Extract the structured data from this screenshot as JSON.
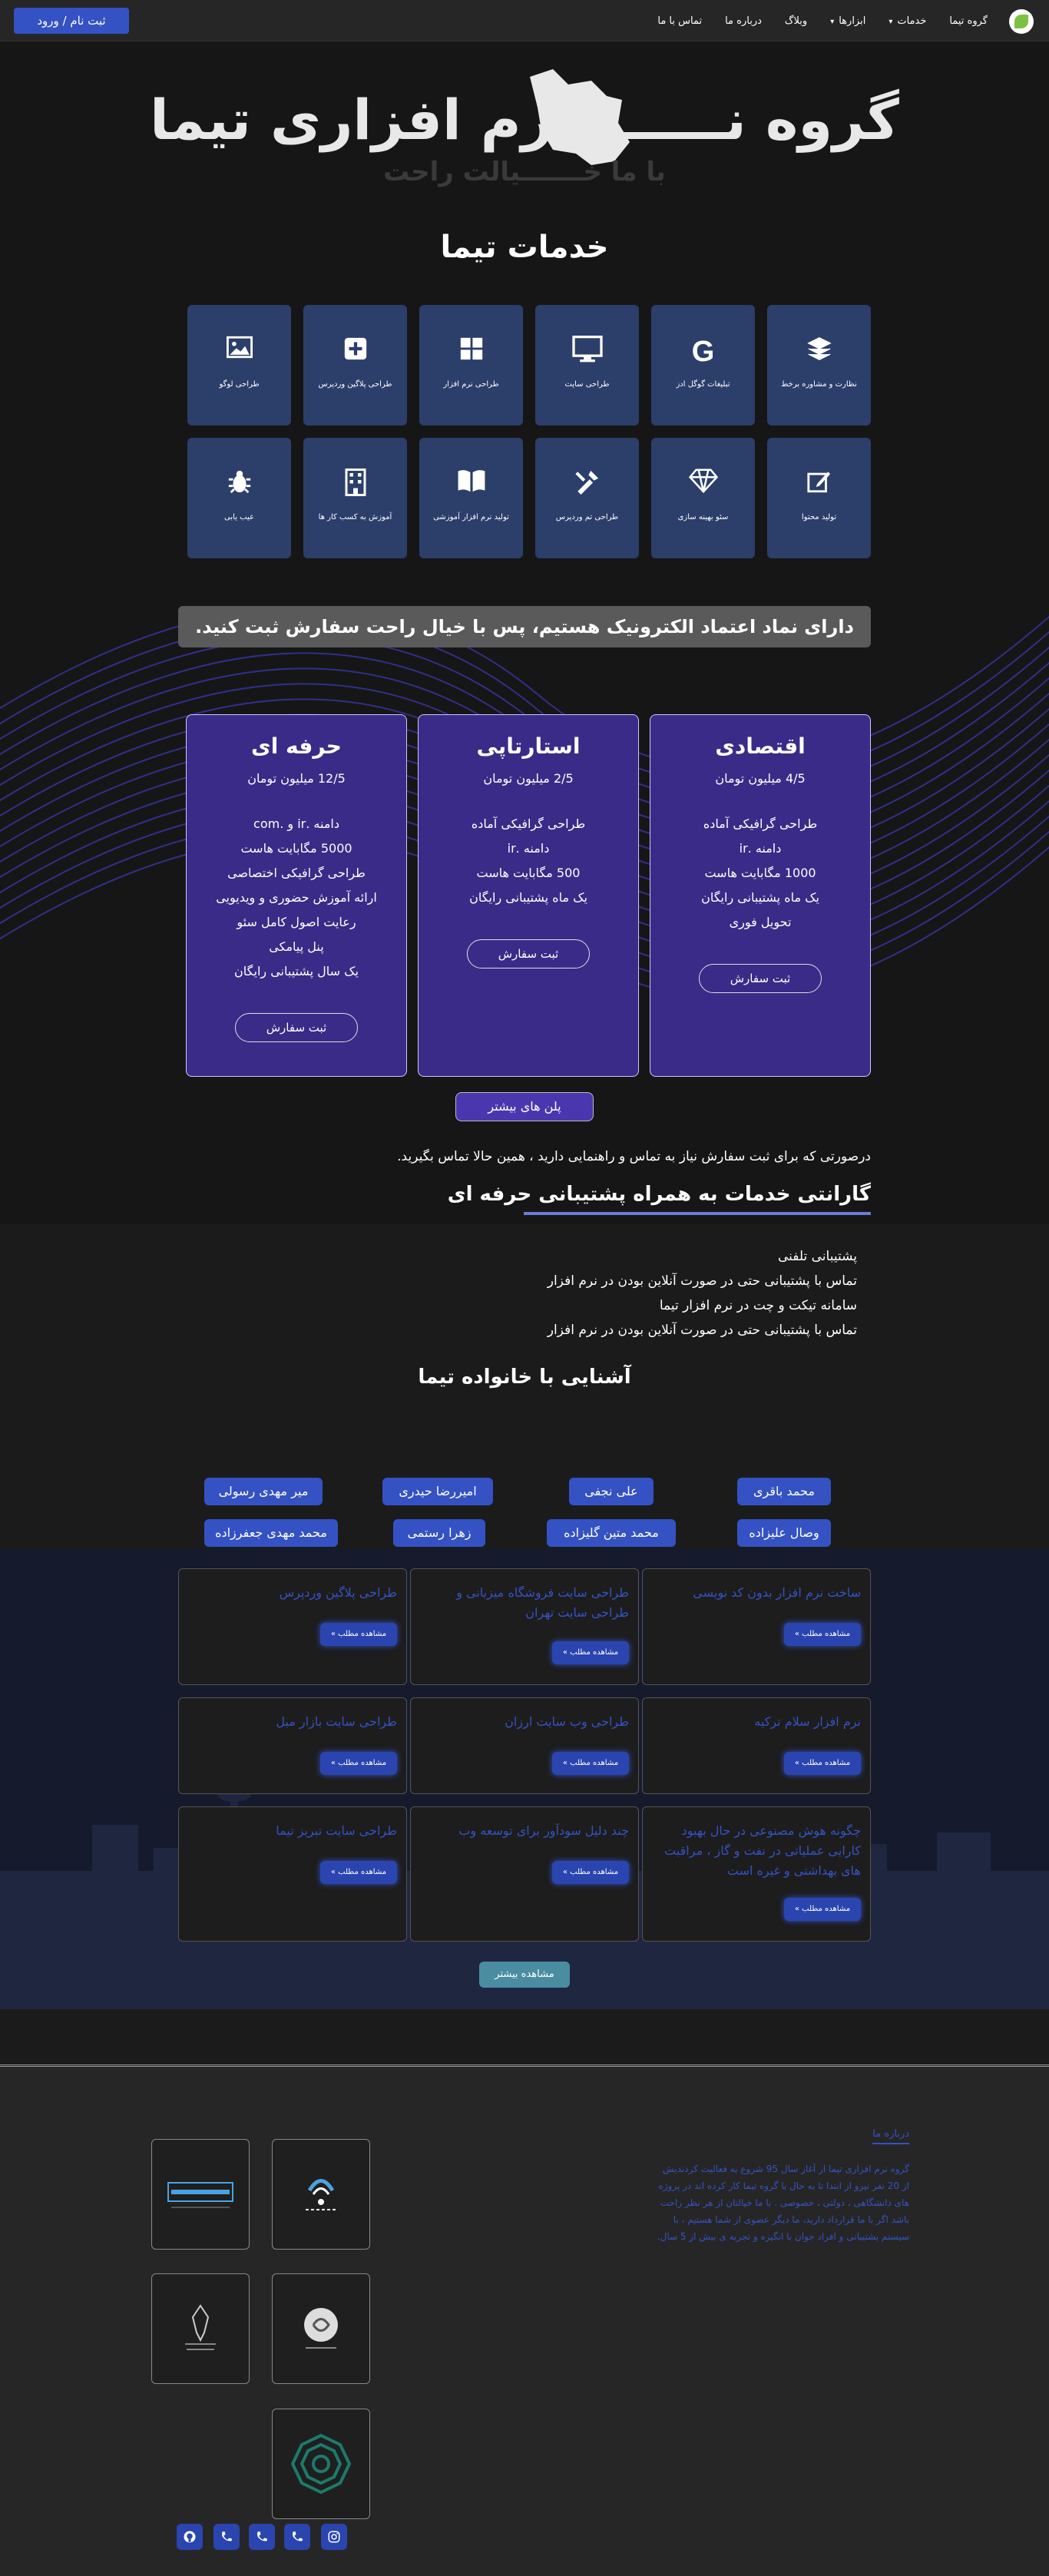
{
  "nav": {
    "brand": "گروه تیما",
    "services": "خدمات",
    "tools": "ابزارها",
    "blog": "وبلاگ",
    "about": "درباره ما",
    "contact": "تماس با ما",
    "login": "ثبت نام / ورود"
  },
  "hero": {
    "title": "گروه نـــــــــرم افزاری تیما",
    "subtitle": "با ما خـــــــیالت راحت"
  },
  "services": {
    "title": "خدمات تیما",
    "items": [
      {
        "label": "نظارت و مشاوره برخط",
        "icon": "layers-icon"
      },
      {
        "label": "تبلیغات گوگل ادز",
        "icon": "google-icon"
      },
      {
        "label": "طراحی سایت",
        "icon": "monitor-icon"
      },
      {
        "label": "طراحی نرم افزار",
        "icon": "windows-icon"
      },
      {
        "label": "طراحی پلاگین وردپرس",
        "icon": "plus-square-icon"
      },
      {
        "label": "طراحی لوگو",
        "icon": "image-icon"
      },
      {
        "label": "تولید محتوا",
        "icon": "edit-icon"
      },
      {
        "label": "سئو بهینه سازی",
        "icon": "diamond-icon"
      },
      {
        "label": "طراحی تم وردپرس",
        "icon": "tools-icon"
      },
      {
        "label": "تولید نرم افزار آموزشی",
        "icon": "book-icon"
      },
      {
        "label": "آموزش به کسب کار ها",
        "icon": "building-icon"
      },
      {
        "label": "عیب یابی",
        "icon": "bug-icon"
      }
    ]
  },
  "trust": "دارای نماد اعتماد الکترونیک هستیم، پس با خیال راحت سفارش ثبت کنید.",
  "plans": [
    {
      "name": "اقتصادی",
      "price": "4/5 میلیون تومان",
      "features": [
        "طراحی گرافیکی آماده",
        "دامنه .ir",
        "1000 مگابایت هاست",
        "یک ماه پشتیبانی رایگان",
        "تحویل فوری"
      ],
      "button": "ثبت سفارش"
    },
    {
      "name": "استارتاپی",
      "price": "2/5 میلیون تومان",
      "features": [
        "طراحی گرافیکی آماده",
        "دامنه .ir",
        "500 مگابایت هاست",
        "یک ماه پشتیبانی رایگان"
      ],
      "button": "ثبت سفارش"
    },
    {
      "name": "حرفه ای",
      "price": "12/5 میلیون تومان",
      "features": [
        "دامنه .ir و .com",
        "5000 مگابایت هاست",
        "طراحی گرافیکی اختصاصی",
        "ارائه آموزش حضوری و ویدیویی",
        "رعایت اصول کامل سئو",
        "پنل پیامکی",
        "یک سال پشتیبانی رایگان"
      ],
      "button": "ثبت سفارش"
    }
  ],
  "more_plans": "پلن های بیشتر",
  "contact_note": "درصورتی که برای ثبت سفارش نیاز به تماس و راهنمایی دارید ، همین حالا تماس بگیرید.",
  "guarantee": {
    "title": "گارانتی خدمات به همراه پشتیبانی حرفه ای",
    "items": [
      "پشتیبانی تلفنی",
      "تماس با پشتیبانی حتی در صورت آنلاین بودن در نرم افزار",
      "سامانه تیکت و چت در نرم افزار تیما",
      "تماس با پشتیبانی حتی در صورت آنلاین بودن در نرم افزار"
    ]
  },
  "family": {
    "title": "آشنایی با خانواده تیما",
    "row1": [
      "محمد باقری",
      "علی نجفی",
      "امیررضا حیدری",
      "میر مهدی رسولی"
    ],
    "row2": [
      "وصال علیزاده",
      "محمد متین گلیزاده",
      "زهرا رستمی",
      "محمد مهدی جعفرزاده"
    ]
  },
  "posts": {
    "button": "مشاهده مطلب »",
    "items": [
      "ساخت نرم افزار بدون کد نویسی",
      "طراحی سایت فروشگاه میزبانی و طراحی سایت تهران",
      "طراحی پلاگین وردپرس",
      "نرم افزار سلام ترکیه",
      "طراحی وب سایت ارزان",
      "طراحی سایت بازار مبل",
      "چگونه هوش مصنوعی در حال بهبود کارایی عملیاتی در نفت و گاز ، مراقبت های بهداشتی و غیره است",
      "چند دلیل سودآور برای توسعه وب",
      "طراحی سایت تبریز تیما"
    ]
  },
  "see_more": "مشاهده بیشتر",
  "footer": {
    "about_title": "درباره ما",
    "about_text": "گروه نرم افزاری تیما از آغاز سال 95 شروع به فعالیت کردندیش از 20 نفر نیرو از ابتدا تا به حال با گروه تیما کار کرده اند در پروژه های دانشگاهی ، دولتی ، خصوصی . با ما خیالتان از هر نظر راحت باشد اگر با ما قرارداد دارید، ما دیگر عضوی از شما هستیم ، با سیستم پشتیبانی و افراد جوان با انگیزه و تجربه ی بیش از 5 سال."
  },
  "colors": {
    "accent": "#3452c4",
    "plan_bg": "#3a2b88",
    "tile_bg": "#2c3e6a"
  }
}
